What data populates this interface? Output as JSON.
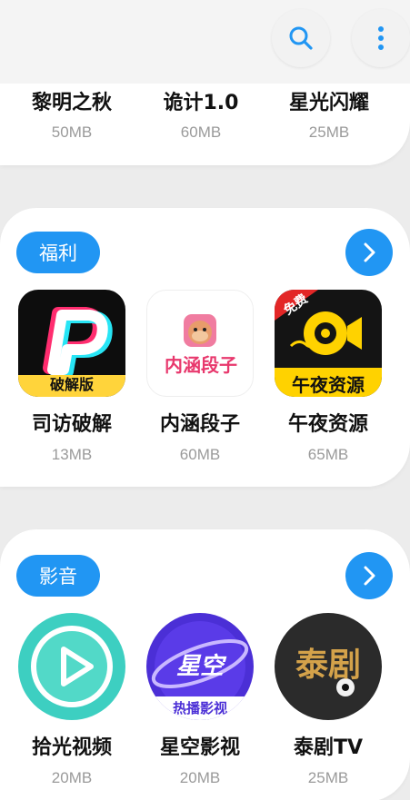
{
  "toolbar": {
    "search_icon": "search-icon",
    "more_icon": "more-vertical-icon",
    "accent": "#2196f3"
  },
  "top_section": {
    "apps": [
      {
        "name": "黎明之秋",
        "size": "50MB"
      },
      {
        "name": "诡计1.0",
        "size": "60MB"
      },
      {
        "name": "星光闪耀",
        "size": "25MB"
      }
    ]
  },
  "welfare": {
    "category": "福利",
    "apps": [
      {
        "name": "司访破解",
        "size": "13MB",
        "badge": "破解版"
      },
      {
        "name": "内涵段子",
        "size": "60MB",
        "icon_text": "内涵段子"
      },
      {
        "name": "午夜资源",
        "size": "65MB",
        "icon_text": "午夜资源",
        "ribbon": "免费"
      }
    ]
  },
  "media": {
    "category": "影音",
    "apps": [
      {
        "name": "拾光视频",
        "size": "20MB"
      },
      {
        "name": "星空影视",
        "size": "20MB",
        "icon_text": "星空",
        "icon_subtext": "热播影视"
      },
      {
        "name": "泰剧TV",
        "size": "25MB",
        "icon_text": "泰剧"
      }
    ]
  }
}
